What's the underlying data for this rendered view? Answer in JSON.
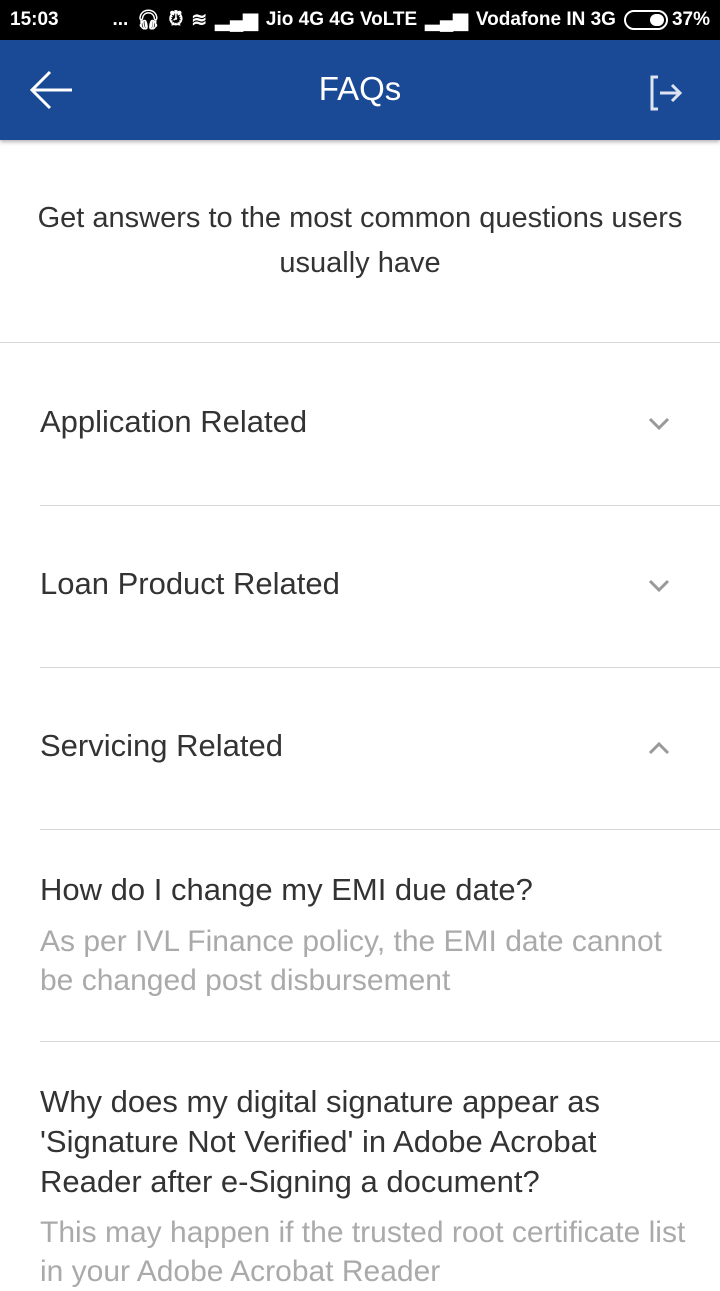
{
  "status_bar": {
    "time": "15:03",
    "dots": "...",
    "carrier1": "Jio 4G 4G VoLTE",
    "carrier2": "Vodafone IN 3G",
    "battery": "37%"
  },
  "header": {
    "title": "FAQs"
  },
  "intro": "Get answers to the most common questions users usually have",
  "sections": [
    {
      "label": "Application Related",
      "expanded": false
    },
    {
      "label": "Loan Product Related",
      "expanded": false
    },
    {
      "label": "Servicing Related",
      "expanded": true
    }
  ],
  "faqs": [
    {
      "question": "How do I change my EMI due date?",
      "answer": "As per IVL Finance policy, the EMI date cannot be changed post disbursement"
    },
    {
      "question": "Why does my digital signature appear as 'Signature Not Verified' in Adobe Acrobat Reader after e-Signing a document?",
      "answer": "This may happen if the trusted root certificate list in your Adobe Acrobat Reader"
    }
  ],
  "colors": {
    "primary": "#1a4a96"
  }
}
